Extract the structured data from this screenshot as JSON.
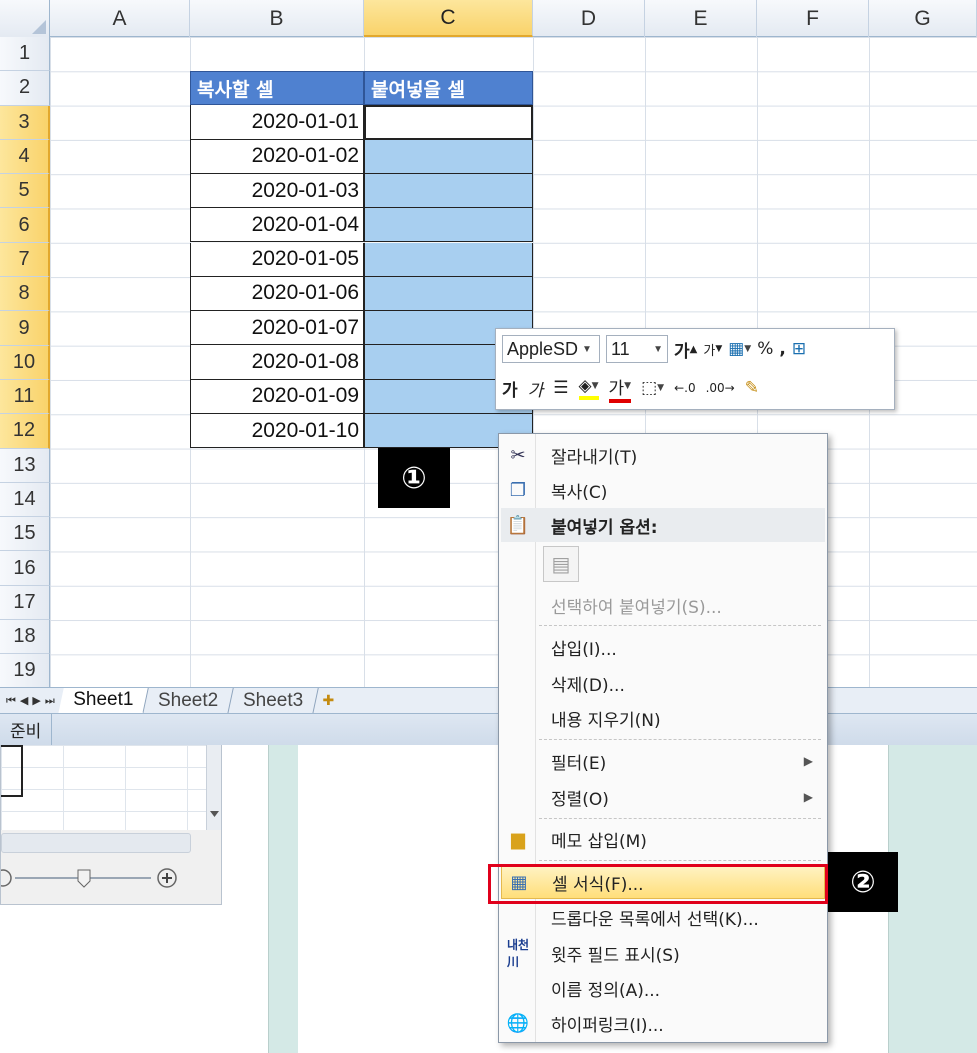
{
  "spreadsheet": {
    "columns": [
      "A",
      "B",
      "C",
      "D",
      "E",
      "F",
      "G"
    ],
    "selected_column": "C",
    "rows": [
      "1",
      "2",
      "3",
      "4",
      "5",
      "6",
      "7",
      "8",
      "9",
      "10",
      "11",
      "12",
      "13",
      "14",
      "15",
      "16",
      "17",
      "18",
      "19"
    ],
    "selected_rows": [
      "3",
      "4",
      "5",
      "6",
      "7",
      "8",
      "9",
      "10",
      "11",
      "12"
    ],
    "header_copy": "복사할 셀",
    "header_paste": "붙여넣을 셀",
    "dates": [
      "2020-01-01",
      "2020-01-02",
      "2020-01-03",
      "2020-01-04",
      "2020-01-05",
      "2020-01-06",
      "2020-01-07",
      "2020-01-08",
      "2020-01-09",
      "2020-01-10"
    ]
  },
  "sheet_tabs": [
    "Sheet1",
    "Sheet2",
    "Sheet3"
  ],
  "active_sheet": "Sheet1",
  "status": {
    "ready": "준비"
  },
  "mini_toolbar": {
    "font_name": "AppleSD",
    "font_size": "11",
    "percent": "%",
    "comma": ","
  },
  "context_menu": {
    "cut": "잘라내기(T)",
    "copy": "복사(C)",
    "paste_options": "붙여넣기 옵션:",
    "paste_special": "선택하여 붙여넣기(S)...",
    "insert": "삽입(I)...",
    "delete": "삭제(D)...",
    "clear_contents": "내용 지우기(N)",
    "filter": "필터(E)",
    "sort": "정렬(O)",
    "insert_comment": "메모 삽입(M)",
    "format_cells": "셀 서식(F)...",
    "pick_from_list": "드롭다운 목록에서 선택(K)...",
    "phonetic": "윗주 필드 표시(S)",
    "define_name": "이름 정의(A)...",
    "hyperlink": "하이퍼링크(I)..."
  },
  "markers": {
    "one": "①",
    "two": "②"
  },
  "colors": {
    "header_blue": "#4f81d0",
    "selection_blue": "#a8cff0",
    "highlight_red": "#e0001b",
    "menu_highlight": "#ffde7a"
  },
  "icons": [
    "scissors-icon",
    "copy-icon",
    "clipboard-icon",
    "comment-icon",
    "format-cells-icon",
    "phonetic-icon",
    "hyperlink-icon"
  ]
}
